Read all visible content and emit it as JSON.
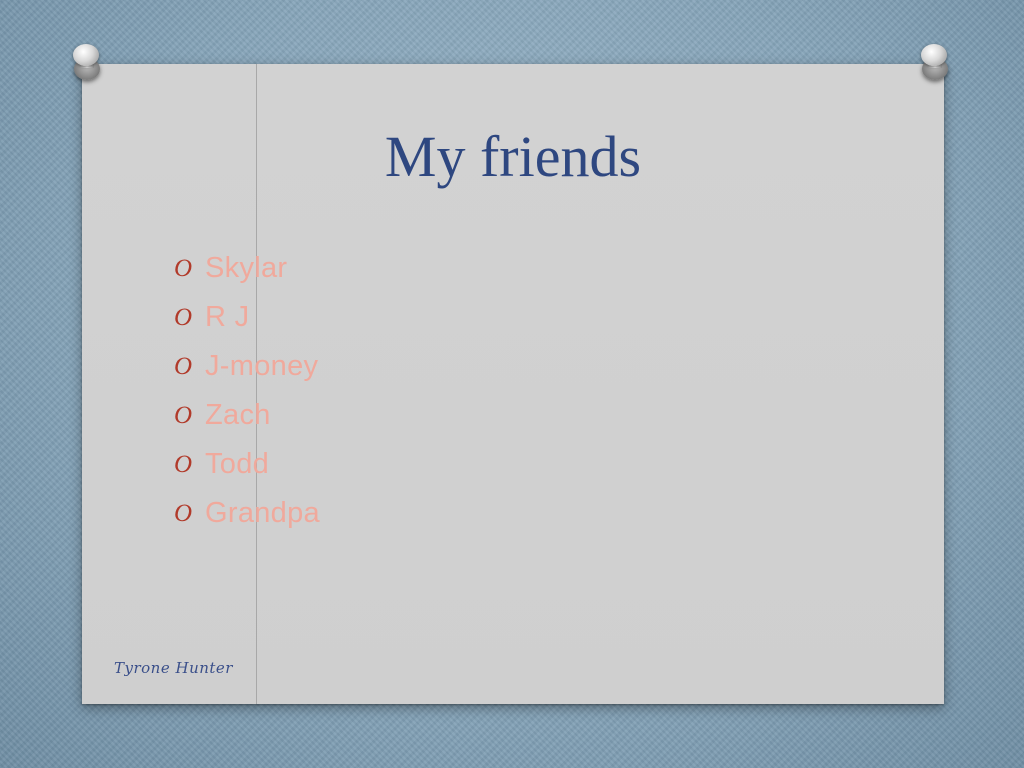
{
  "slide": {
    "title": "My friends",
    "bullet_symbol": "O",
    "items": [
      "Skylar",
      "R J",
      "J-money",
      "Zach",
      "Todd",
      "Grandpa"
    ],
    "footer_signature": "Tyrone Hunter"
  },
  "colors": {
    "title": "#2e4780",
    "bullet_symbol": "#b13a2a",
    "bullet_text": "#f0a99c",
    "sheet": "#d0d0d0",
    "background": "#8aa9bd"
  }
}
